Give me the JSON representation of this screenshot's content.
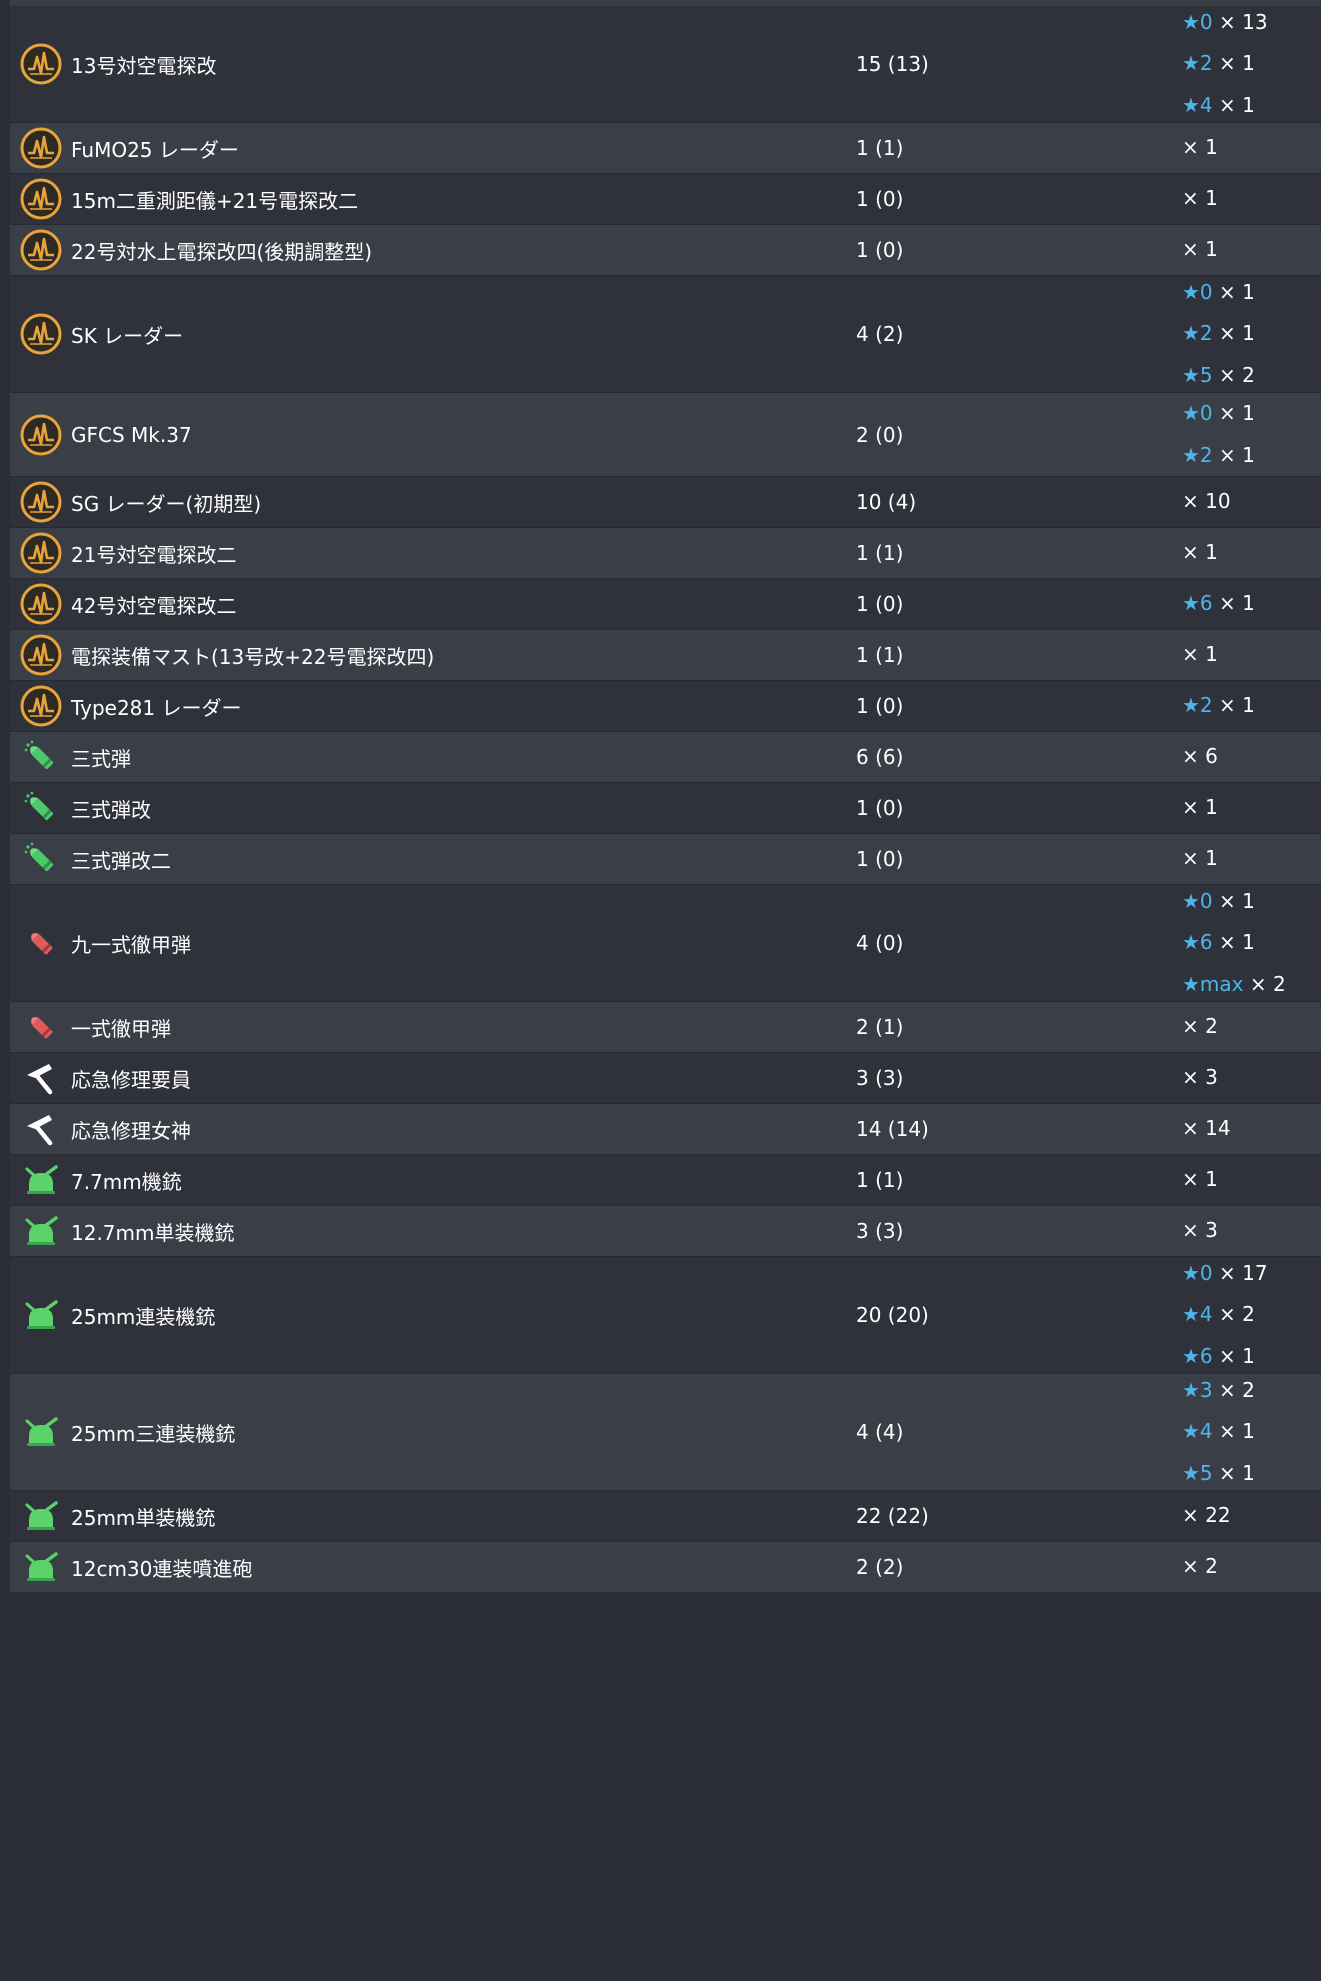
{
  "equipment_rows": [
    {
      "name": "13号対空電探改",
      "count": "15 (13)",
      "icon": "radar-icon",
      "improvements": [
        {
          "star": "★0",
          "times": "× 13"
        },
        {
          "star": "★2",
          "times": "× 1"
        },
        {
          "star": "★4",
          "times": "× 1"
        }
      ]
    },
    {
      "name": "FuMO25 レーダー",
      "count": "1 (1)",
      "icon": "radar-icon",
      "improvements": [
        {
          "star": "",
          "times": "× 1"
        }
      ]
    },
    {
      "name": "15m二重測距儀+21号電探改二",
      "count": "1 (0)",
      "icon": "radar-icon",
      "improvements": [
        {
          "star": "",
          "times": "× 1"
        }
      ]
    },
    {
      "name": "22号対水上電探改四(後期調整型)",
      "count": "1 (0)",
      "icon": "radar-icon",
      "improvements": [
        {
          "star": "",
          "times": "× 1"
        }
      ]
    },
    {
      "name": "SK レーダー",
      "count": "4 (2)",
      "icon": "radar-icon",
      "improvements": [
        {
          "star": "★0",
          "times": "× 1"
        },
        {
          "star": "★2",
          "times": "× 1"
        },
        {
          "star": "★5",
          "times": "× 2"
        }
      ]
    },
    {
      "name": "GFCS Mk.37",
      "count": "2 (0)",
      "icon": "radar-icon",
      "improvements": [
        {
          "star": "★0",
          "times": "× 1"
        },
        {
          "star": "★2",
          "times": "× 1"
        }
      ]
    },
    {
      "name": "SG レーダー(初期型)",
      "count": "10 (4)",
      "icon": "radar-icon",
      "improvements": [
        {
          "star": "",
          "times": "× 10"
        }
      ]
    },
    {
      "name": "21号対空電探改二",
      "count": "1 (1)",
      "icon": "radar-icon",
      "improvements": [
        {
          "star": "",
          "times": "× 1"
        }
      ]
    },
    {
      "name": "42号対空電探改二",
      "count": "1 (0)",
      "icon": "radar-icon",
      "improvements": [
        {
          "star": "★6",
          "times": "× 1"
        }
      ]
    },
    {
      "name": "電探装備マスト(13号改+22号電探改四)",
      "count": "1 (1)",
      "icon": "radar-icon",
      "improvements": [
        {
          "star": "",
          "times": "× 1"
        }
      ]
    },
    {
      "name": "Type281 レーダー",
      "count": "1 (0)",
      "icon": "radar-icon",
      "improvements": [
        {
          "star": "★2",
          "times": "× 1"
        }
      ]
    },
    {
      "name": "三式弾",
      "count": "6 (6)",
      "icon": "type3-shell-icon",
      "improvements": [
        {
          "star": "",
          "times": "× 6"
        }
      ]
    },
    {
      "name": "三式弾改",
      "count": "1 (0)",
      "icon": "type3-shell-icon",
      "improvements": [
        {
          "star": "",
          "times": "× 1"
        }
      ]
    },
    {
      "name": "三式弾改二",
      "count": "1 (0)",
      "icon": "type3-shell-icon",
      "improvements": [
        {
          "star": "",
          "times": "× 1"
        }
      ]
    },
    {
      "name": "九一式徹甲弾",
      "count": "4 (0)",
      "icon": "ap-shell-icon",
      "improvements": [
        {
          "star": "★0",
          "times": "× 1"
        },
        {
          "star": "★6",
          "times": "× 1"
        },
        {
          "star": "★max",
          "times": "× 2"
        }
      ]
    },
    {
      "name": "一式徹甲弾",
      "count": "2 (1)",
      "icon": "ap-shell-icon",
      "improvements": [
        {
          "star": "",
          "times": "× 2"
        }
      ]
    },
    {
      "name": "応急修理要員",
      "count": "3 (3)",
      "icon": "repair-hammer-icon",
      "improvements": [
        {
          "star": "",
          "times": "× 3"
        }
      ]
    },
    {
      "name": "応急修理女神",
      "count": "14 (14)",
      "icon": "repair-hammer-icon",
      "improvements": [
        {
          "star": "",
          "times": "× 14"
        }
      ]
    },
    {
      "name": "7.7mm機銃",
      "count": "1 (1)",
      "icon": "aa-gun-icon",
      "improvements": [
        {
          "star": "",
          "times": "× 1"
        }
      ]
    },
    {
      "name": "12.7mm単装機銃",
      "count": "3 (3)",
      "icon": "aa-gun-icon",
      "improvements": [
        {
          "star": "",
          "times": "× 3"
        }
      ]
    },
    {
      "name": "25mm連装機銃",
      "count": "20 (20)",
      "icon": "aa-gun-icon",
      "improvements": [
        {
          "star": "★0",
          "times": "× 17"
        },
        {
          "star": "★4",
          "times": "× 2"
        },
        {
          "star": "★6",
          "times": "× 1"
        }
      ]
    },
    {
      "name": "25mm三連装機銃",
      "count": "4 (4)",
      "icon": "aa-gun-icon",
      "improvements": [
        {
          "star": "★3",
          "times": "× 2"
        },
        {
          "star": "★4",
          "times": "× 1"
        },
        {
          "star": "★5",
          "times": "× 1"
        }
      ]
    },
    {
      "name": "25mm単装機銃",
      "count": "22 (22)",
      "icon": "aa-gun-icon",
      "improvements": [
        {
          "star": "",
          "times": "× 22"
        }
      ]
    },
    {
      "name": "12cm30連装噴進砲",
      "count": "2 (2)",
      "icon": "aa-gun-icon",
      "improvements": [
        {
          "star": "",
          "times": "× 2"
        }
      ]
    }
  ],
  "colors": {
    "star": "#4fb4e8",
    "radar_icon": "#e8a33a",
    "type3_shell_icon": "#4cc96a",
    "ap_shell_icon": "#e05a5a",
    "aa_gun_icon": "#5bd36b"
  }
}
